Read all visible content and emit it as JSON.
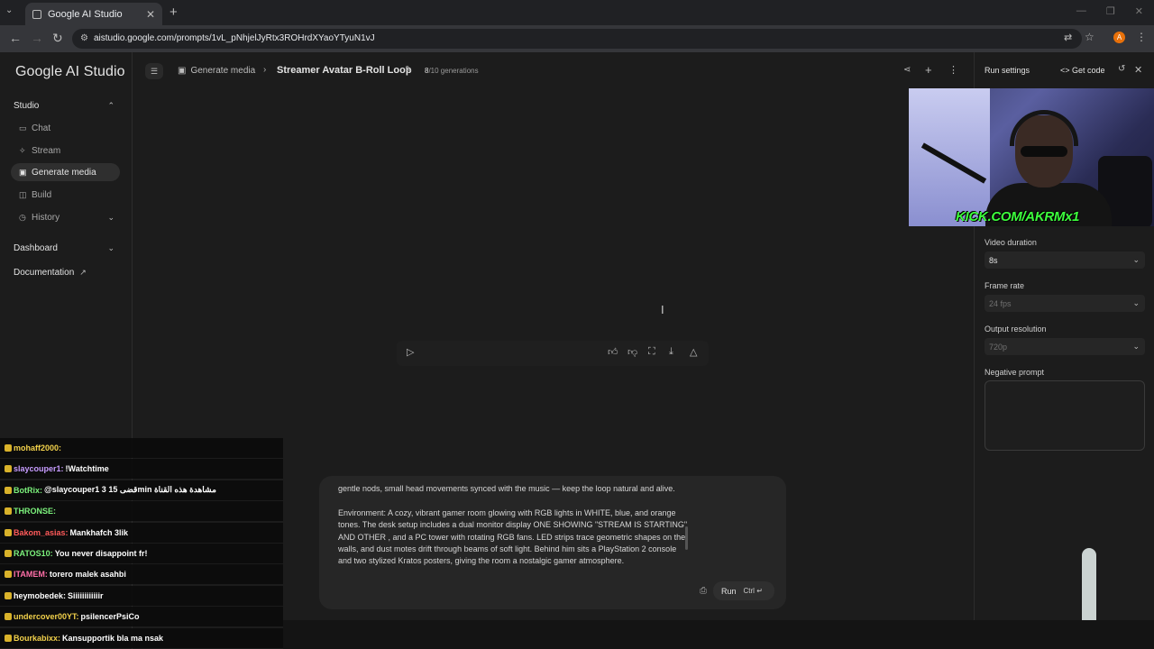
{
  "browser": {
    "tab_title": "Google AI Studio",
    "url": "aistudio.google.com/prompts/1vL_pNhjelJyRtx3ROHrdXYaoYTyuN1vJ",
    "profile_initial": "A"
  },
  "sidebar": {
    "logo": "Google AI Studio",
    "studio_label": "Studio",
    "items": [
      {
        "label": "Chat",
        "icon": "chat-icon"
      },
      {
        "label": "Stream",
        "icon": "stream-icon"
      },
      {
        "label": "Generate media",
        "icon": "media-icon"
      },
      {
        "label": "Build",
        "icon": "build-icon"
      },
      {
        "label": "History",
        "icon": "history-icon"
      }
    ],
    "dashboard_label": "Dashboard",
    "documentation_label": "Documentation"
  },
  "topbar": {
    "crumb_parent": "Generate media",
    "crumb_title": "Streamer Avatar B-Roll Loop",
    "gen_current": "8",
    "gen_total": "/10 generations"
  },
  "right_panel": {
    "run_settings": "Run settings",
    "get_code": "Get code",
    "video_duration_label": "Video duration",
    "video_duration_value": "8s",
    "frame_rate_label": "Frame rate",
    "frame_rate_value": "24 fps",
    "output_resolution_label": "Output resolution",
    "output_resolution_value": "720p",
    "negative_prompt_label": "Negative prompt"
  },
  "webcam": {
    "overlay_text": "KICK.COM/AKRMx1"
  },
  "prompt": {
    "text": "gentle nods, small head movements synced with the music — keep the loop natural and alive.\n\nEnvironment: A cozy, vibrant gamer room glowing with RGB lights in WHITE, blue, and orange tones. The desk setup includes a dual monitor display ONE SHOWING \"STREAM IS STARTING\" AND OTHER , and a PC tower with rotating RGB fans. LED strips trace geometric shapes on the walls, and dust motes drift through beams of soft light. Behind him sits a PlayStation 2 console and two stylized Kratos posters, giving the room a nostalgic gamer atmosphere.",
    "run_label": "Run",
    "run_shortcut": "Ctrl"
  },
  "chat": [
    {
      "user": "mohaff2000:",
      "msg": "",
      "color": "#f2d14b"
    },
    {
      "user": "slaycouper1:",
      "msg": "!Watchtime",
      "color": "#c79cff"
    },
    {
      "user": "BotRix:",
      "msg": "@slaycouper1 3 قضى 15min مشاهدة هذه القناة",
      "color": "#7cf27c"
    },
    {
      "user": "THRONSE:",
      "msg": "",
      "color": "#7cf27c"
    },
    {
      "user": "Bakom_asias:",
      "msg": "Mankhafch 3lik",
      "color": "#ff5a5a"
    },
    {
      "user": "RATOS10:",
      "msg": "You never disappoint fr!",
      "color": "#7cf27c"
    },
    {
      "user": "ITAMEM:",
      "msg": "torero malek asahbi",
      "color": "#ff6fa8"
    },
    {
      "user": "heymobedek:",
      "msg": "Siiiiiiiiiiiir",
      "color": "#ffffff"
    },
    {
      "user": "undercover00YT:",
      "msg": "psilencerPsiCo",
      "color": "#f2d14b"
    },
    {
      "user": "Bourkabixx:",
      "msg": "Kansupportik bla ma nsak",
      "color": "#f2d14b"
    }
  ]
}
